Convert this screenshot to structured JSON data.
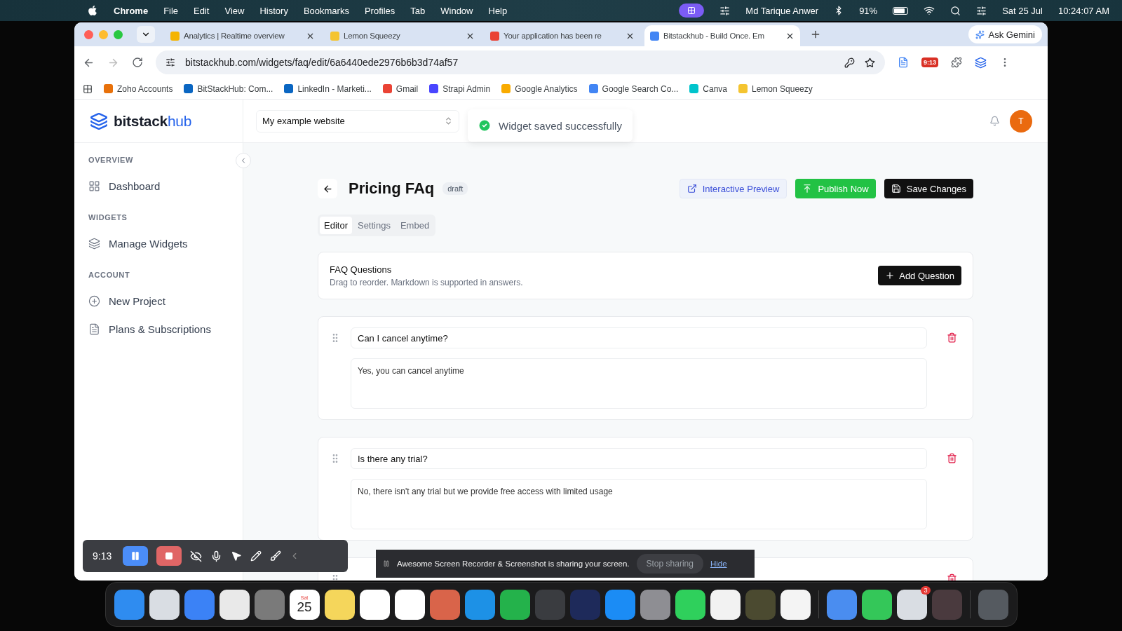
{
  "menu_bar": {
    "app": "Chrome",
    "menus": [
      "File",
      "Edit",
      "View",
      "History",
      "Bookmarks",
      "Profiles",
      "Tab",
      "Window",
      "Help"
    ],
    "user": "Md Tarique Anwer",
    "battery": "91%",
    "date": "Sat 25 Jul",
    "time": "10:24:07 AM"
  },
  "browser": {
    "tabs": [
      {
        "title": "Analytics | Realtime overview",
        "selected": false
      },
      {
        "title": "Lemon Squeezy",
        "selected": false
      },
      {
        "title": "Your application has been re",
        "selected": false
      },
      {
        "title": "Bitstackhub - Build Once. Em",
        "selected": true
      }
    ],
    "ask_gemini": "Ask Gemini",
    "url": "bitstackhub.com/widgets/faq/edit/6a6440ede2976b6b3d74af57",
    "extension_badge": "9:13",
    "bookmarks": [
      "Zoho Accounts",
      "BitStackHub: Com...",
      "LinkedIn - Marketi...",
      "Gmail",
      "Strapi Admin",
      "Google Analytics",
      "Google Search Co...",
      "Canva",
      "Lemon Squeezy"
    ]
  },
  "app": {
    "logo": {
      "main": "bitstack",
      "accent": "hub"
    },
    "project_select": "My example website",
    "toast": "Widget saved successfully",
    "avatar": "T",
    "sidebar": [
      {
        "heading": "OVERVIEW",
        "items": [
          {
            "label": "Dashboard",
            "kind": "grid"
          }
        ]
      },
      {
        "heading": "WIDGETS",
        "items": [
          {
            "label": "Manage Widgets",
            "kind": "layers"
          }
        ]
      },
      {
        "heading": "ACCOUNT",
        "items": [
          {
            "label": "New Project",
            "kind": "plus"
          },
          {
            "label": "Plans & Subscriptions",
            "kind": "file"
          }
        ]
      }
    ],
    "title": "Pricing FAq",
    "status": "draft",
    "actions": [
      {
        "label": "Interactive Preview",
        "kind": "preview"
      },
      {
        "label": "Publish Now",
        "kind": "publish"
      },
      {
        "label": "Save Changes",
        "kind": "save"
      }
    ],
    "tabs": [
      {
        "label": "Editor",
        "selected": true
      },
      {
        "label": "Settings",
        "selected": false
      },
      {
        "label": "Embed",
        "selected": false
      }
    ],
    "faq_header": {
      "title": "FAQ Questions",
      "subtitle": "Drag to reorder. Markdown is supported in answers.",
      "add": "Add Question"
    },
    "questions": [
      {
        "question": "Can I cancel anytime?",
        "answer": "Yes, you can cancel anytime"
      },
      {
        "question": "Is there any trial?",
        "answer": "No, there isn't any trial but we provide free access with limited usage"
      }
    ]
  },
  "recorder": {
    "time": "9:13"
  },
  "share_bar": {
    "message": "Awesome Screen Recorder & Screenshot is sharing your screen.",
    "stop": "Stop sharing",
    "hide": "Hide"
  },
  "dock": {
    "calendar_weekday": "Sat",
    "calendar_date": "25",
    "badge": "3"
  }
}
